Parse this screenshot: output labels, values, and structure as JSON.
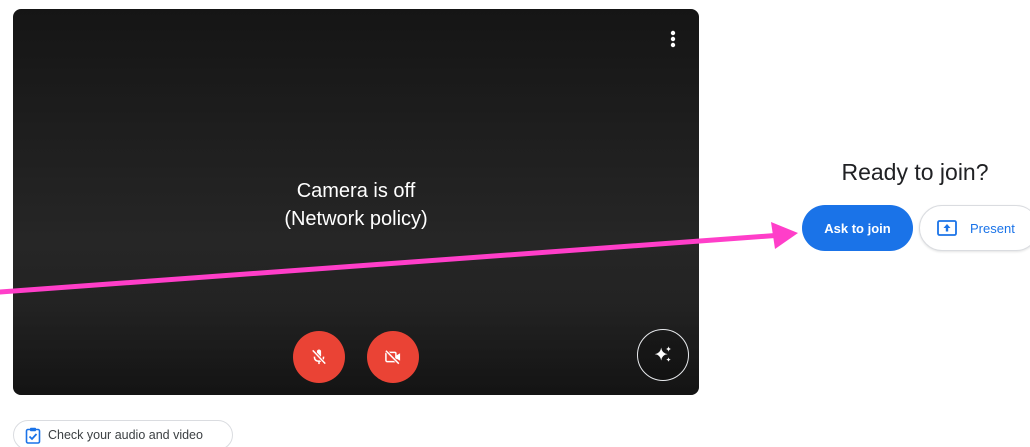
{
  "preview": {
    "camera_off_line1": "Camera is off",
    "camera_off_line2": "(Network policy)",
    "more_options_icon": "more-vert-icon",
    "mic_icon": "mic-off-icon",
    "camera_icon": "videocam-off-icon",
    "effects_icon": "sparkle-icon"
  },
  "join": {
    "title": "Ready to join?",
    "ask_label": "Ask to join",
    "present_label": "Present",
    "present_icon": "present-to-all-icon"
  },
  "check": {
    "label": "Check your audio and video",
    "icon": "clipboard-check-icon"
  },
  "colors": {
    "accent": "#1a73e8",
    "danger": "#ea4335",
    "annotation": "#ff3ec9"
  }
}
